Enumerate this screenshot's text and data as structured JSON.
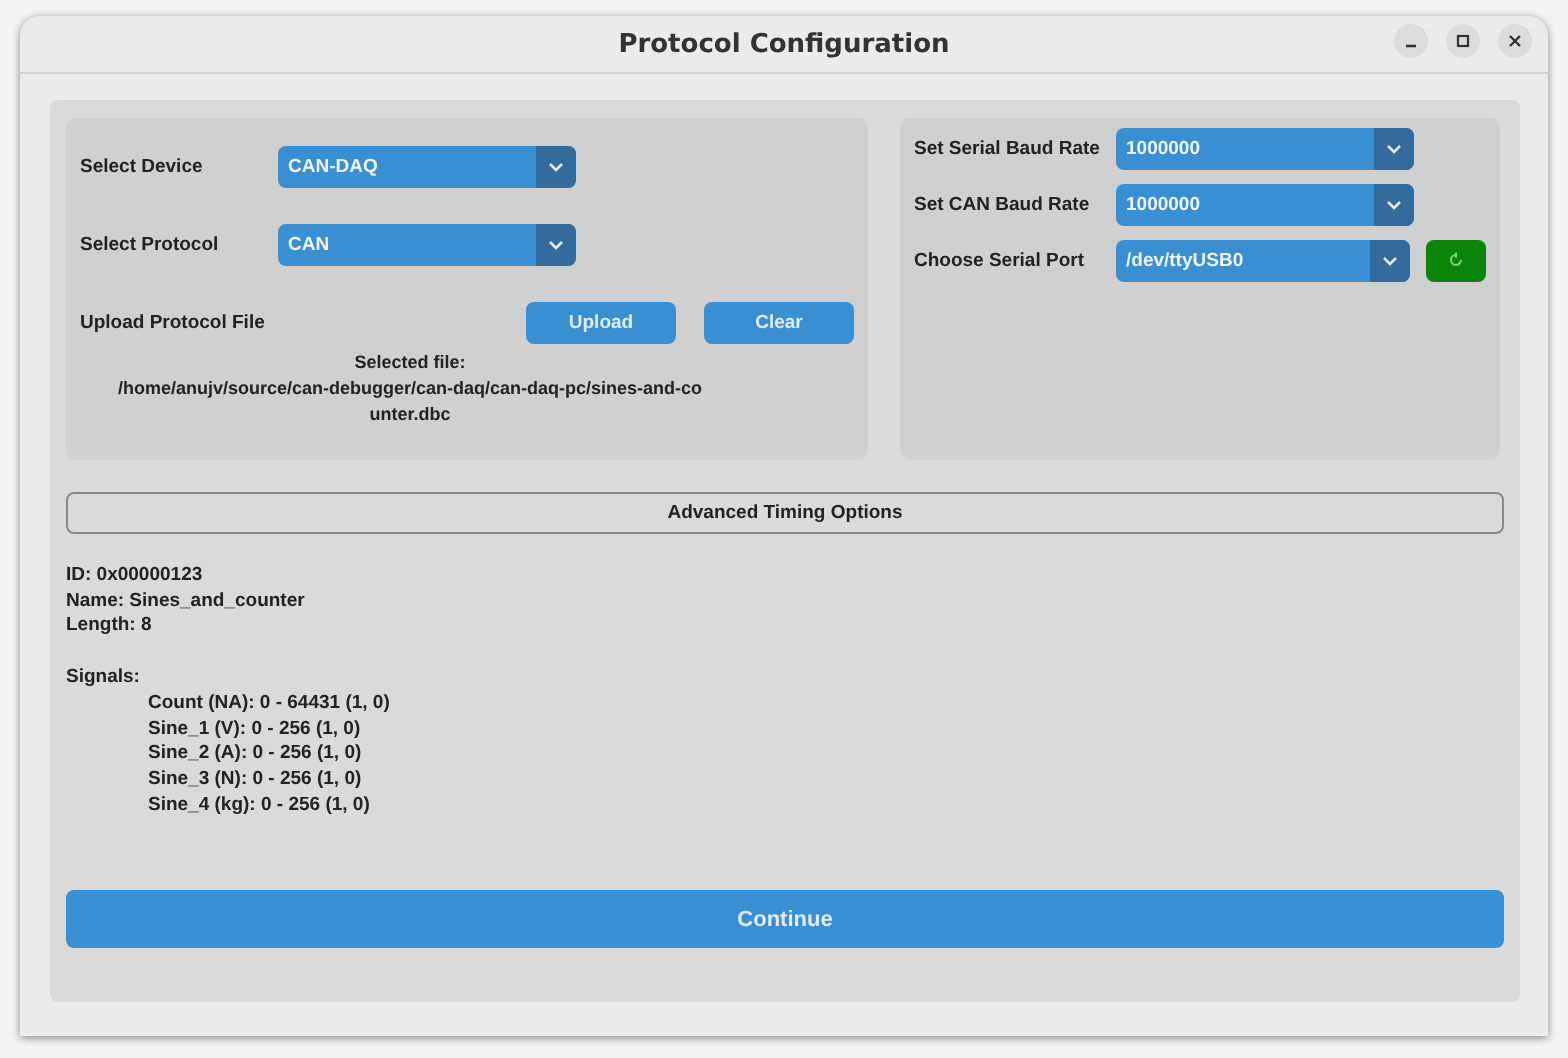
{
  "window": {
    "title": "Protocol Configuration"
  },
  "device_panel": {
    "rows": [
      {
        "label": "Select Device",
        "value": "CAN-DAQ"
      },
      {
        "label": "Select Protocol",
        "value": "CAN"
      }
    ],
    "upload": {
      "label": "Upload Protocol File",
      "buttons": [
        "Upload",
        "Clear"
      ]
    },
    "selected_file": [
      "Selected file:",
      "/home/anujv/source/can-debugger/can-daq/can-daq-pc/sines-and-co",
      "unter.dbc"
    ]
  },
  "serial_panel": {
    "rows": [
      {
        "label": "Set Serial Baud Rate",
        "value": "1000000",
        "refresh": false
      },
      {
        "label": "Set CAN Baud Rate",
        "value": "1000000",
        "refresh": false
      },
      {
        "label": "Choose Serial Port",
        "value": "/dev/ttyUSB0",
        "refresh": true
      }
    ]
  },
  "advanced_button": "Advanced Timing Options",
  "message": {
    "lines": [
      "ID: 0x00000123",
      "Name: Sines_and_counter",
      "Length: 8"
    ],
    "signals_heading": "Signals:",
    "signals": [
      "Count (NA): 0 - 64431 (1, 0)",
      "Sine_1 (V): 0 - 256 (1, 0)",
      "Sine_2 (A): 0 - 256 (1, 0)",
      "Sine_3 (N): 0 - 256 (1, 0)",
      "Sine_4 (kg): 0 - 256 (1, 0)"
    ]
  },
  "continue_button": "Continue"
}
